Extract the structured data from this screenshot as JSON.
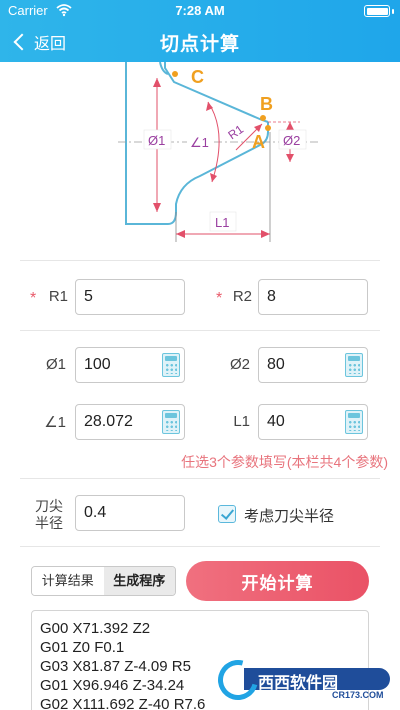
{
  "status_bar": {
    "carrier": "Carrier",
    "time": "7:28 AM"
  },
  "nav": {
    "back_label": "返回",
    "title": "切点计算"
  },
  "diagram": {
    "point_c": "C",
    "point_b": "B",
    "point_a": "A",
    "dim_r1": "R1",
    "dim_phi1": "Ø1",
    "dim_phi2": "Ø2",
    "dim_angle1": "∠1",
    "dim_l1": "L1"
  },
  "form": {
    "r1": {
      "label": "R1",
      "value": "5",
      "required": true
    },
    "r2": {
      "label": "R2",
      "value": "8",
      "required": true
    },
    "phi1": {
      "label": "Ø1",
      "value": "100"
    },
    "phi2": {
      "label": "Ø2",
      "value": "80"
    },
    "angle1": {
      "label": "∠1",
      "value": "28.072"
    },
    "l1": {
      "label": "L1",
      "value": "40"
    },
    "hint": "任选3个参数填写(本栏共4个参数)",
    "tool_radius": {
      "label_line1": "刀尖",
      "label_line2": "半径",
      "value": "0.4"
    },
    "consider_tool_radius": {
      "label": "考虑刀尖半径",
      "checked": true
    }
  },
  "tabs": [
    {
      "label": "计算结果",
      "active": true
    },
    {
      "label": "生成程序",
      "active": false
    }
  ],
  "start_button": "开始计算",
  "result_lines": [
    "G00 X71.392 Z2",
    "G01 Z0 F0.1",
    "G03 X81.87 Z-4.09 R5",
    "G01 X96.946 Z-34.24",
    "G02 X111.692 Z-40 R7.6"
  ],
  "watermark": {
    "text": "西西软件园",
    "sub": "CR173.COM"
  },
  "colors": {
    "header_blue": "#1fa6ea",
    "accent_pink": "#ea5266",
    "required_star": "#e95b6b",
    "hint_red": "#e8747d",
    "diagram_line": "#5ab6d8",
    "diagram_red": "#e2506a",
    "diagram_label": "#9a3fa0",
    "point_orange": "#f0a020"
  },
  "icons": [
    "back-chevron-icon",
    "wifi-icon",
    "battery-icon",
    "calculator-icon",
    "checkbox-checked-icon"
  ]
}
